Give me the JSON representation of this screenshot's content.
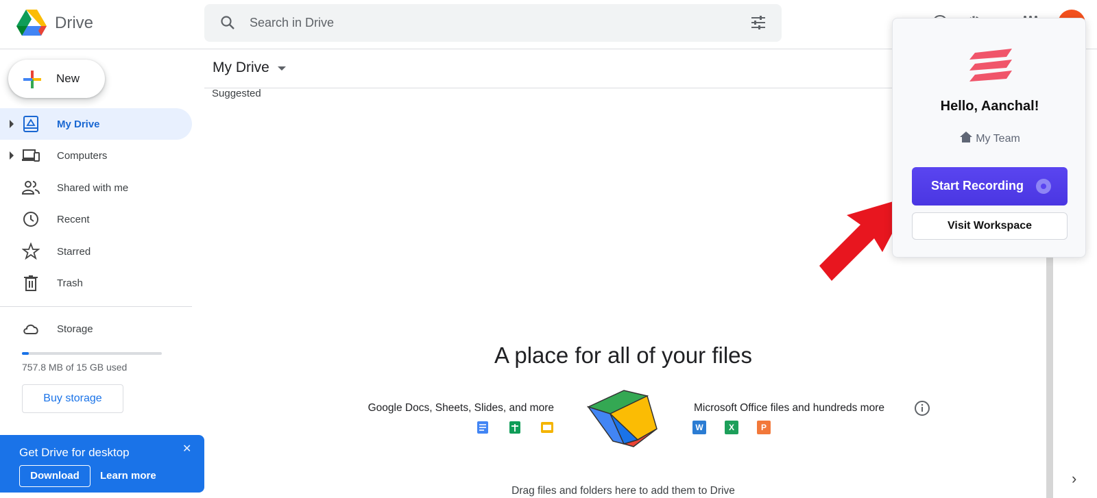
{
  "header": {
    "brand": "Drive",
    "search_placeholder": "Search in Drive",
    "icons": [
      "drive-logo-icon",
      "search-icon",
      "filter-options-icon",
      "help-icon",
      "settings-icon",
      "apps-grid-icon",
      "account-avatar"
    ]
  },
  "sidebar": {
    "new_label": "New",
    "items": [
      {
        "label": "My Drive",
        "icon": "my-drive-icon",
        "active": true,
        "expandable": true
      },
      {
        "label": "Computers",
        "icon": "computers-icon",
        "active": false,
        "expandable": true
      },
      {
        "label": "Shared with me",
        "icon": "shared-icon",
        "active": false,
        "expandable": false
      },
      {
        "label": "Recent",
        "icon": "clock-icon",
        "active": false,
        "expandable": false
      },
      {
        "label": "Starred",
        "icon": "star-icon",
        "active": false,
        "expandable": false
      },
      {
        "label": "Trash",
        "icon": "trash-icon",
        "active": false,
        "expandable": false
      }
    ],
    "storage": {
      "label": "Storage",
      "used_text": "757.8 MB of 15 GB used",
      "used_fraction": 0.05,
      "buy_label": "Buy storage"
    },
    "desktop_banner": {
      "title": "Get Drive for desktop",
      "download_label": "Download",
      "learn_more_label": "Learn more"
    }
  },
  "main": {
    "title": "My Drive",
    "suggested_label": "Suggested",
    "empty_title": "A place for all of your files",
    "docs_text": "Google Docs, Sheets, Slides, and more",
    "office_text": "Microsoft Office files and hundreds more",
    "office_letters": [
      "W",
      "X",
      "P"
    ],
    "drag_text": "Drag files and folders here to add them to Drive"
  },
  "popup": {
    "greeting": "Hello, Aanchal!",
    "team": "My Team",
    "start_recording_label": "Start Recording",
    "visit_workspace_label": "Visit Workspace"
  },
  "colors": {
    "accent": "#1a73e8",
    "active_nav_bg": "#e8f0fe",
    "record_button": "#5a45f0",
    "popup_logo": "#f0556a",
    "arrow": "#e8161f"
  }
}
